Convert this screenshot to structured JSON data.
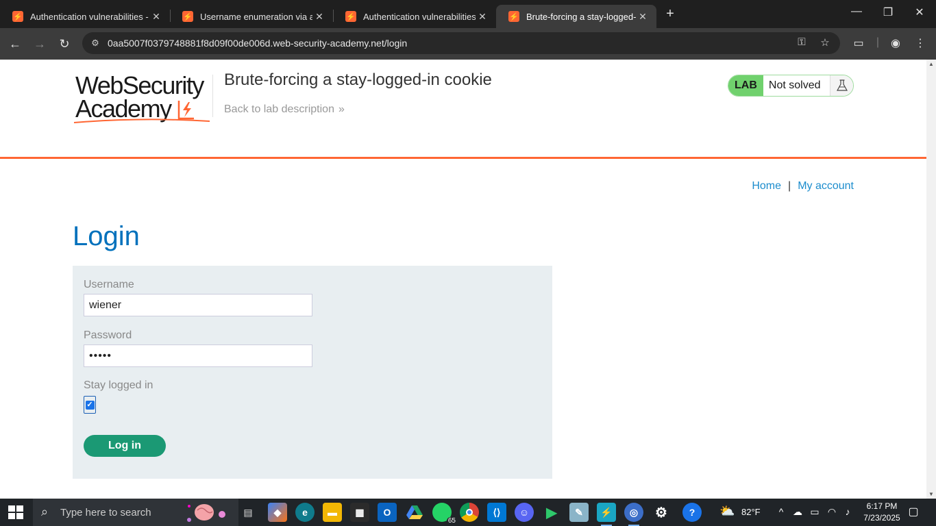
{
  "browser": {
    "tabs": [
      {
        "title": "Authentication vulnerabilities - ",
        "active": false
      },
      {
        "title": "Username enumeration via acco",
        "active": false
      },
      {
        "title": "Authentication vulnerabilities - ",
        "active": false
      },
      {
        "title": "Brute-forcing a stay-logged-in c",
        "active": true
      }
    ],
    "tab_close_glyph": "✕",
    "new_tab_glyph": "+",
    "url": "0aa5007f0379748881f8d09f00de006d.web-security-academy.net/login"
  },
  "header": {
    "logo_line1": "WebSecurity",
    "logo_line2": "Academy",
    "lab_title": "Brute-forcing a stay-logged-in cookie",
    "back_link": "Back to lab description",
    "back_chevron": "»",
    "lab_label": "LAB",
    "lab_status": "Not solved"
  },
  "nav": {
    "home": "Home",
    "separator": "|",
    "my_account": "My account"
  },
  "login": {
    "heading": "Login",
    "username_label": "Username",
    "username_value": "wiener",
    "password_label": "Password",
    "password_value": "•••••",
    "stay_logged_in_label": "Stay logged in",
    "stay_logged_in_checked": true,
    "submit_label": "Log in"
  },
  "taskbar": {
    "search_placeholder": "Type here to search",
    "whatsapp_badge": "65",
    "weather": "82°F",
    "time": "6:17 PM",
    "date": "7/23/2025"
  },
  "colors": {
    "accent_orange": "#ff6633",
    "link_blue": "#1b8ccd",
    "heading_blue": "#0071bc",
    "button_green": "#1b9974",
    "lab_green": "#70d16d"
  }
}
